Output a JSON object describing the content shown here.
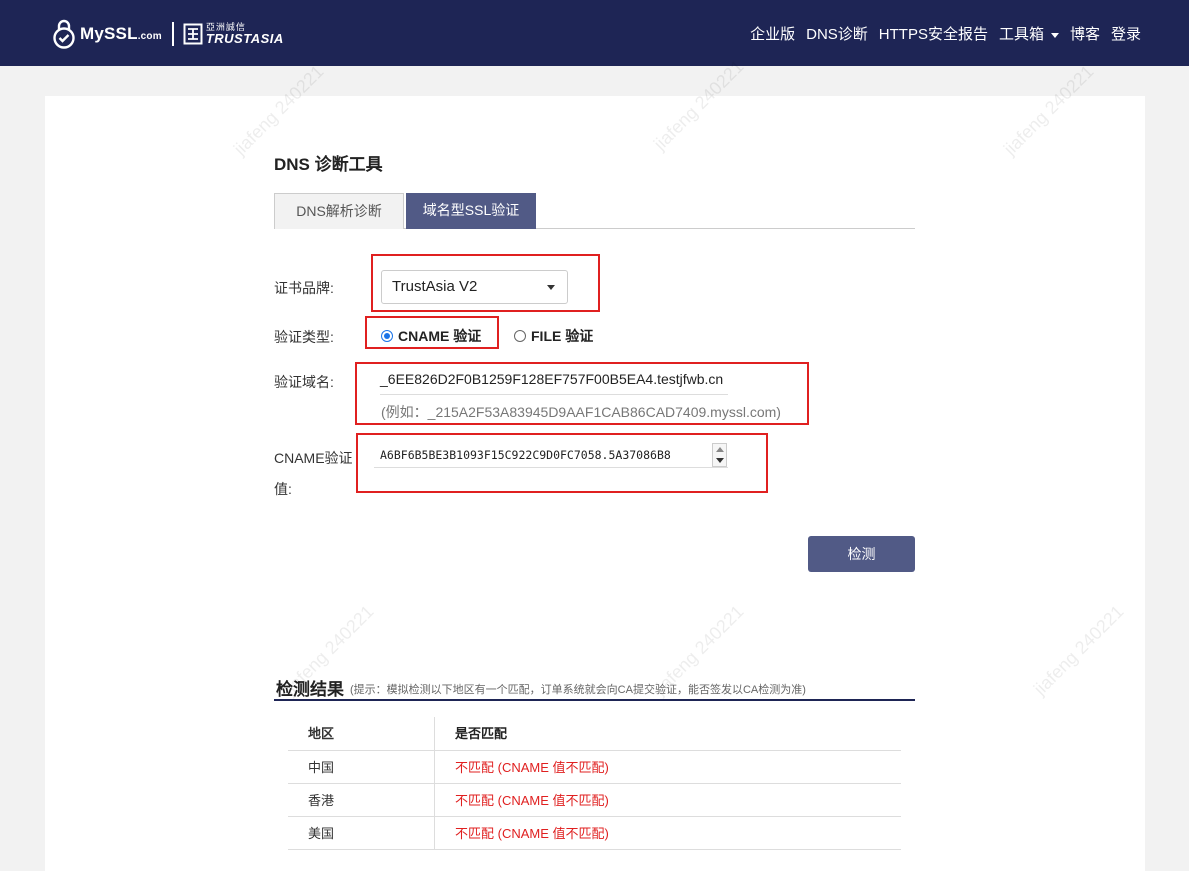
{
  "header": {
    "logo_main": "MySSL",
    "logo_suffix": ".com",
    "partner_cn": "亞洲誠信",
    "partner_en": "TRUSTASIA",
    "nav": [
      "企业版",
      "DNS诊断",
      "HTTPS安全报告",
      "工具箱",
      "博客",
      "登录"
    ]
  },
  "page": {
    "title": "DNS 诊断工具",
    "tabs": [
      {
        "label": "DNS解析诊断",
        "active": false
      },
      {
        "label": "域名型SSL验证",
        "active": true
      }
    ]
  },
  "form": {
    "brand_label": "证书品牌:",
    "brand_value": "TrustAsia V2",
    "type_label": "验证类型:",
    "type_options": [
      {
        "label": "CNAME 验证",
        "checked": true
      },
      {
        "label": "FILE 验证",
        "checked": false
      }
    ],
    "domain_label": "验证域名:",
    "domain_value": "_6EE826D2F0B1259F128EF757F00B5EA4.testjfwb.cn",
    "domain_hint": "(例如：_215A2F53A83945D9AAF1CAB86CAD7409.myssl.com)",
    "cname_label_1": "CNAME验证",
    "cname_label_2": "值:",
    "cname_value": "A6BF6B5BE3B1093F15C922C9D0FC7058.5A37086B8",
    "submit_label": "检测"
  },
  "result": {
    "title": "检测结果",
    "hint": "(提示：模拟检测以下地区有一个匹配，订单系统就会向CA提交验证，能否签发以CA检测为准)",
    "columns": [
      "地区",
      "是否匹配"
    ],
    "rows": [
      {
        "region": "中国",
        "status": "不匹配 (CNAME 值不匹配)"
      },
      {
        "region": "香港",
        "status": "不匹配 (CNAME 值不匹配)"
      },
      {
        "region": "美国",
        "status": "不匹配 (CNAME 值不匹配)"
      }
    ]
  },
  "watermark": "jiafeng 240221",
  "colors": {
    "header_bg": "#1e2555",
    "accent": "#515a86",
    "error": "#e02020",
    "annotation_box": "#e02020"
  }
}
